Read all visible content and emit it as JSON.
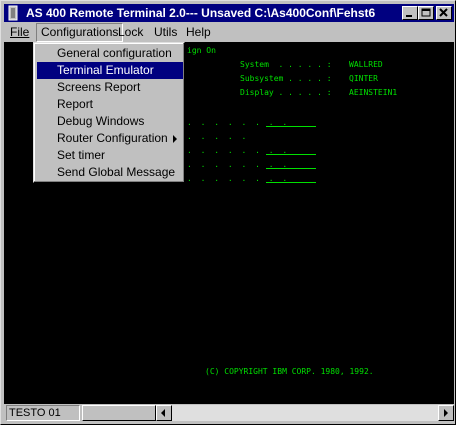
{
  "window": {
    "title": "AS 400 Remote Terminal 2.0--- Unsaved C:\\As400Conf\\Fehst6"
  },
  "menubar": {
    "items": [
      {
        "label": "File"
      },
      {
        "label": "Configurations"
      },
      {
        "label": "Lock"
      },
      {
        "label": "Utils"
      },
      {
        "label": "Help"
      }
    ]
  },
  "configurations_menu": {
    "items": [
      {
        "label": "General configuration"
      },
      {
        "label": "Terminal Emulator"
      },
      {
        "label": "Screens Report"
      },
      {
        "label": "Report"
      },
      {
        "label": "Debug Windows"
      },
      {
        "label": "Router Configuration"
      },
      {
        "label": "Set timer"
      },
      {
        "label": "Send Global Message"
      }
    ],
    "selected": "Terminal Emulator"
  },
  "terminal": {
    "screen_title": "ign On",
    "system_label": "System  . . . . . :",
    "system_value": "WALLRED",
    "subsystem_label": "Subsystem . . . . :",
    "subsystem_value": "QINTER",
    "display_label": "Display . . . . . :",
    "display_value": "AEINSTEIN1",
    "copyright": "(C) COPYRIGHT IBM CORP. 1980, 1992."
  },
  "statusbar": {
    "field": "TESTO 01"
  },
  "colors": {
    "titlebar": "#000080",
    "terminal_bg": "#000000",
    "terminal_text": "#00e000",
    "menu_highlight": "#000080"
  }
}
